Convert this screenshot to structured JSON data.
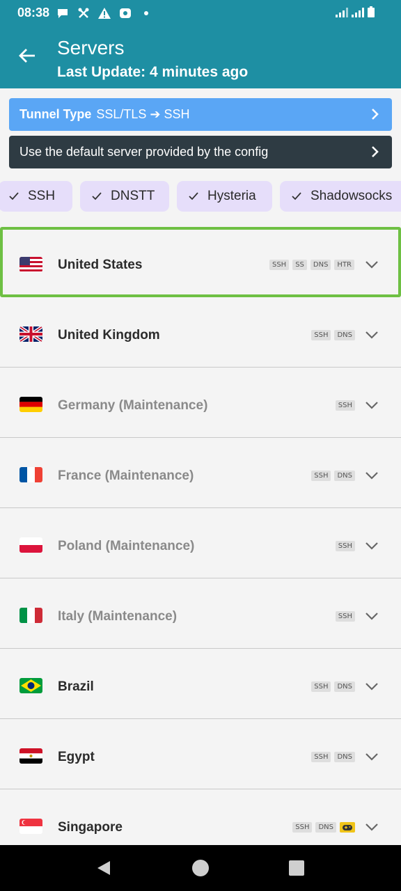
{
  "status": {
    "time": "08:38"
  },
  "header": {
    "title": "Servers",
    "subtitle": "Last Update: 4 minutes ago"
  },
  "tunnel": {
    "label": "Tunnel Type",
    "value": "SSL/TLS ➔ SSH"
  },
  "server_select": {
    "label": "Use the default server provided by the config"
  },
  "chips": [
    "SSH",
    "DNSTT",
    "Hysteria",
    "Shadowsocks"
  ],
  "servers": [
    {
      "name": "United States",
      "tags": [
        "SSH",
        "SS",
        "DNS",
        "HTR"
      ]
    },
    {
      "name": "United Kingdom",
      "tags": [
        "SSH",
        "DNS"
      ]
    },
    {
      "name": "Germany (Maintenance)",
      "tags": [
        "SSH"
      ]
    },
    {
      "name": "France (Maintenance)",
      "tags": [
        "SSH",
        "DNS"
      ]
    },
    {
      "name": "Poland (Maintenance)",
      "tags": [
        "SSH"
      ]
    },
    {
      "name": "Italy (Maintenance)",
      "tags": [
        "SSH"
      ]
    },
    {
      "name": "Brazil",
      "tags": [
        "SSH",
        "DNS"
      ]
    },
    {
      "name": "Egypt",
      "tags": [
        "SSH",
        "DNS"
      ]
    },
    {
      "name": "Singapore",
      "tags": [
        "SSH",
        "DNS"
      ]
    }
  ],
  "colors": {
    "appbar": "#1e8fa3",
    "tunnel": "#5aa6f5",
    "server": "#2e3b43",
    "chip": "#e6defa",
    "selected": "#6ec043"
  }
}
